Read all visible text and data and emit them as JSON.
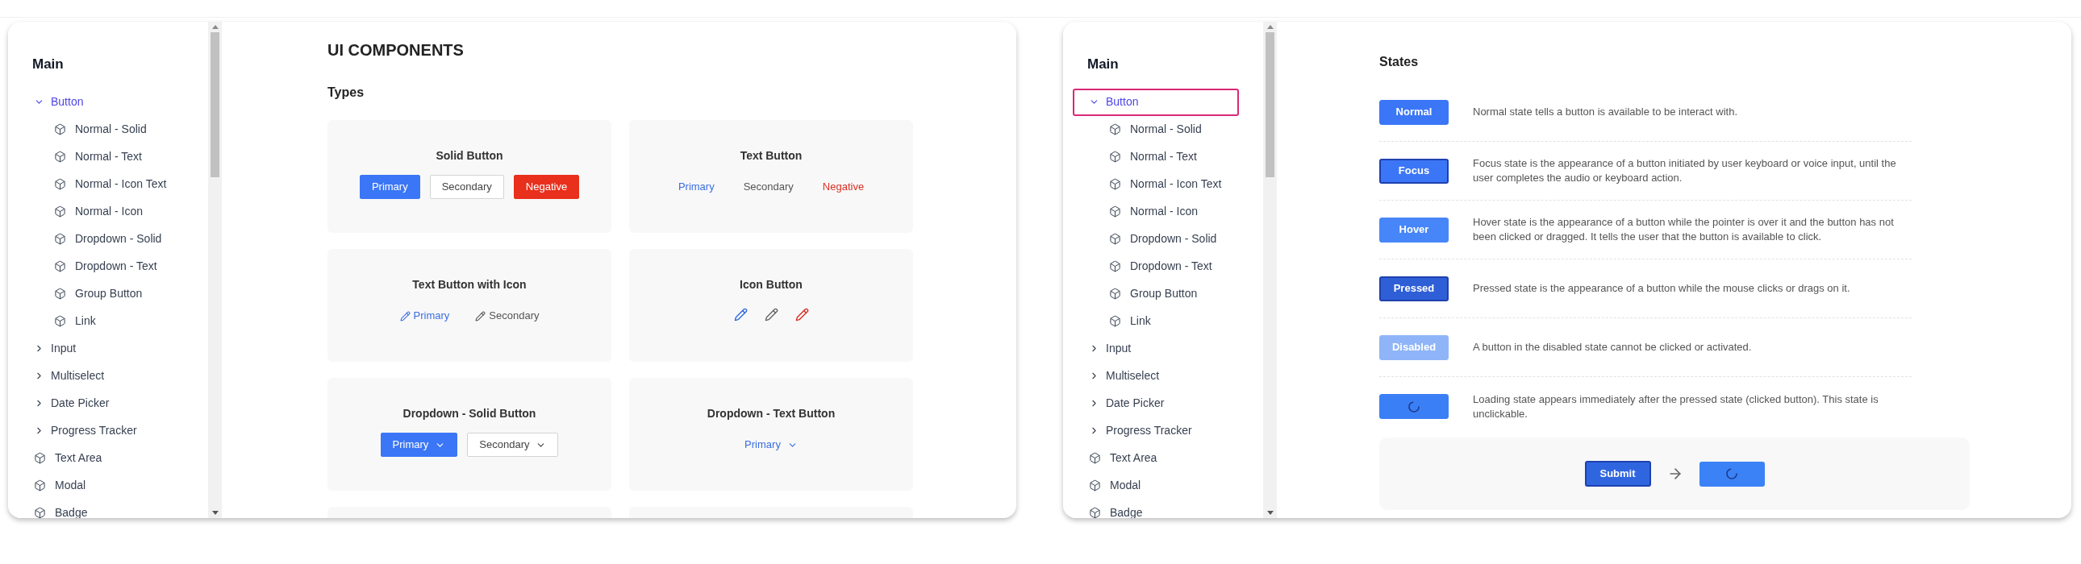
{
  "panels": [
    {
      "sidebar": {
        "heading": "Main",
        "items": [
          {
            "kind": "group",
            "label": "Button",
            "expanded": true,
            "selected": true,
            "focused": false,
            "children": [
              {
                "label": "Normal - Solid"
              },
              {
                "label": "Normal - Text"
              },
              {
                "label": "Normal - Icon Text"
              },
              {
                "label": "Normal - Icon"
              },
              {
                "label": "Dropdown - Solid"
              },
              {
                "label": "Dropdown - Text"
              },
              {
                "label": "Group Button"
              },
              {
                "label": "Link"
              }
            ]
          },
          {
            "kind": "group",
            "label": "Input",
            "expanded": false,
            "selected": false,
            "focused": false
          },
          {
            "kind": "group",
            "label": "Multiselect",
            "expanded": false,
            "selected": false,
            "focused": false
          },
          {
            "kind": "group",
            "label": "Date Picker",
            "expanded": false,
            "selected": false,
            "focused": false
          },
          {
            "kind": "group",
            "label": "Progress Tracker",
            "expanded": false,
            "selected": false,
            "focused": false
          },
          {
            "kind": "leaf",
            "label": "Text Area",
            "selected": false,
            "focused": false
          },
          {
            "kind": "leaf",
            "label": "Modal",
            "selected": false,
            "focused": false
          },
          {
            "kind": "leaf",
            "label": "Badge",
            "selected": false,
            "focused": false
          }
        ]
      },
      "content": {
        "kind": "types",
        "title": "UI COMPONENTS",
        "subtitle": "Types",
        "cards": [
          {
            "title": "Solid Button",
            "kind": "solid",
            "buttons": [
              {
                "label": "Primary",
                "kind": "primary"
              },
              {
                "label": "Secondary",
                "kind": "secondary"
              },
              {
                "label": "Negative",
                "kind": "negative"
              }
            ]
          },
          {
            "title": "Text Button",
            "kind": "text",
            "buttons": [
              {
                "label": "Primary",
                "kind": "primary"
              },
              {
                "label": "Secondary",
                "kind": "secondary"
              },
              {
                "label": "Negative",
                "kind": "negative"
              }
            ]
          },
          {
            "title": "Text Button with Icon",
            "kind": "icon_text",
            "buttons": [
              {
                "label": "Primary",
                "kind": "primary"
              },
              {
                "label": "Secondary",
                "kind": "secondary"
              }
            ]
          },
          {
            "title": "Icon Button",
            "kind": "icon",
            "buttons": [
              {
                "kind": "primary"
              },
              {
                "kind": "secondary"
              },
              {
                "kind": "negative"
              }
            ]
          },
          {
            "title": "Dropdown - Solid Button",
            "kind": "dropdown_solid",
            "buttons": [
              {
                "label": "Primary",
                "kind": "primary"
              },
              {
                "label": "Secondary",
                "kind": "secondary"
              }
            ]
          },
          {
            "title": "Dropdown - Text Button",
            "kind": "dropdown_text",
            "buttons": [
              {
                "label": "Primary",
                "kind": "primary"
              }
            ]
          },
          {
            "kind": "empty"
          },
          {
            "kind": "empty"
          }
        ]
      }
    },
    {
      "sidebar": {
        "heading": "Main",
        "items": [
          {
            "kind": "group",
            "label": "Button",
            "expanded": true,
            "selected": true,
            "focused": true,
            "children": [
              {
                "label": "Normal - Solid"
              },
              {
                "label": "Normal - Text"
              },
              {
                "label": "Normal - Icon Text"
              },
              {
                "label": "Normal - Icon"
              },
              {
                "label": "Dropdown - Solid"
              },
              {
                "label": "Dropdown - Text"
              },
              {
                "label": "Group Button"
              },
              {
                "label": "Link"
              }
            ]
          },
          {
            "kind": "group",
            "label": "Input",
            "expanded": false,
            "selected": false,
            "focused": false
          },
          {
            "kind": "group",
            "label": "Multiselect",
            "expanded": false,
            "selected": false,
            "focused": false
          },
          {
            "kind": "group",
            "label": "Date Picker",
            "expanded": false,
            "selected": false,
            "focused": false
          },
          {
            "kind": "group",
            "label": "Progress Tracker",
            "expanded": false,
            "selected": false,
            "focused": false
          },
          {
            "kind": "leaf",
            "label": "Text Area",
            "selected": false,
            "focused": false
          },
          {
            "kind": "leaf",
            "label": "Modal",
            "selected": false,
            "focused": false
          },
          {
            "kind": "leaf",
            "label": "Badge",
            "selected": false,
            "focused": false
          }
        ]
      },
      "content": {
        "kind": "states",
        "title": "States",
        "states": [
          {
            "kind": "normal",
            "label": "Normal",
            "description": "Normal state tells a button is available to be interact with."
          },
          {
            "kind": "focus",
            "label": "Focus",
            "description": "Focus state is the appearance of a button initiated by user keyboard or voice input, until the user completes the audio or keyboard action."
          },
          {
            "kind": "hover",
            "label": "Hover",
            "description": "Hover state is the appearance of a button while the pointer is over it and the button has not been clicked or dragged. It tells the user that the button is available to click."
          },
          {
            "kind": "pressed",
            "label": "Pressed",
            "description": "Pressed state is the appearance of a button while the mouse clicks or drags on it."
          },
          {
            "kind": "disabled",
            "label": "Disabled",
            "description": "A button in the disabled state cannot be clicked or activated."
          },
          {
            "kind": "loading",
            "description": "Loading state appears immediately after the pressed state (clicked button). This state is unclickable."
          }
        ],
        "demo": {
          "button_label": "Submit"
        }
      }
    }
  ]
}
